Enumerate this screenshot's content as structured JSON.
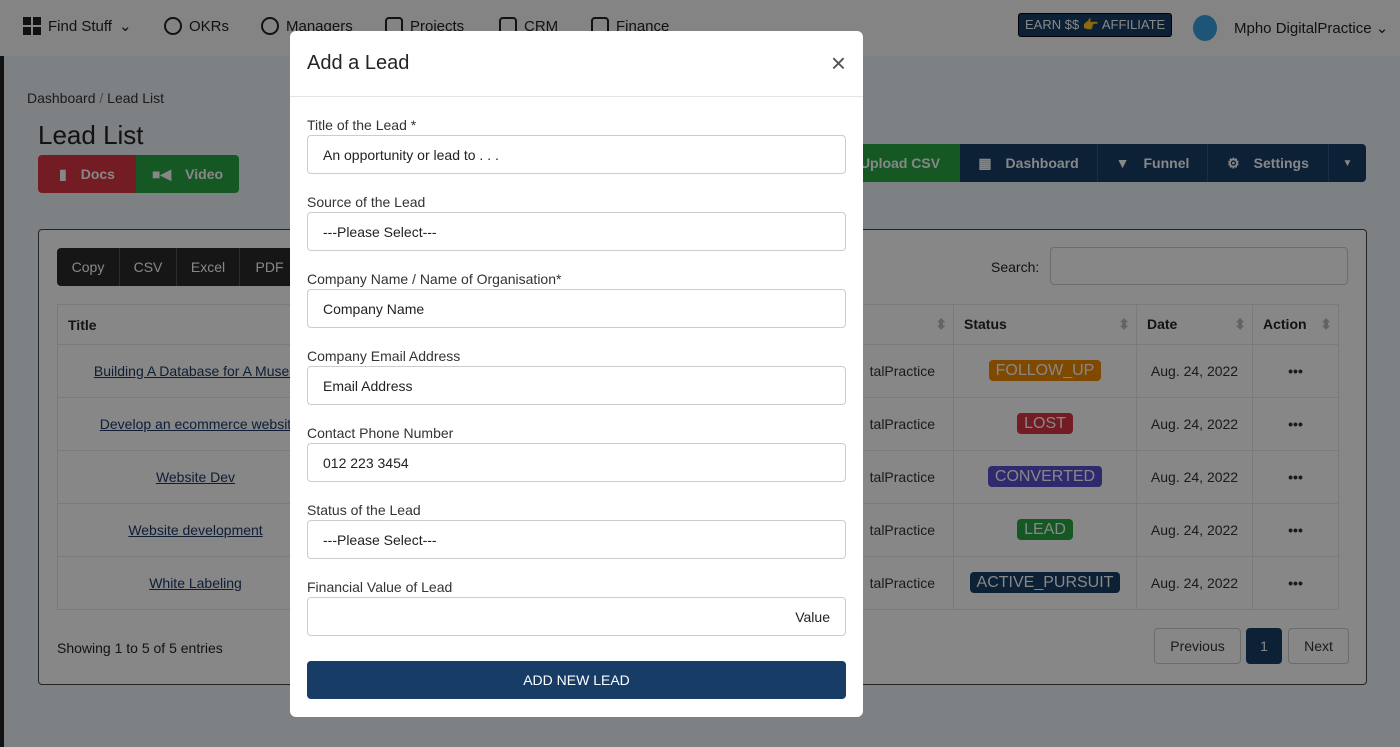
{
  "nav": {
    "items": [
      "Find Stuff",
      "OKRs",
      "Managers",
      "Projects",
      "CRM",
      "Finance"
    ],
    "affiliate": "EARN $$ 👉 AFFILIATE",
    "user": "Mpho DigitalPractice"
  },
  "breadcrumb": [
    "Dashboard",
    "/",
    "Lead List"
  ],
  "page_title": "Lead List",
  "buttons": {
    "docs": "Docs",
    "video": "Video",
    "upload": "Upload CSV",
    "dashboard": "Dashboard",
    "funnel": "Funnel",
    "settings": "Settings"
  },
  "export": [
    "Copy",
    "CSV",
    "Excel",
    "PDF"
  ],
  "search_label": "Search:",
  "table": {
    "headers": {
      "title": "Title",
      "status": "Status",
      "date": "Date",
      "action": "Action"
    },
    "rows": [
      {
        "title": "Building A Database for A Museu",
        "owner": "talPractice",
        "status": "FOLLOW_UP",
        "color": "#f08c00",
        "date": "Aug. 24, 2022"
      },
      {
        "title": "Develop an ecommerce websit",
        "owner": "talPractice",
        "status": "LOST",
        "color": "#dc3545",
        "date": "Aug. 24, 2022"
      },
      {
        "title": "Website Dev",
        "owner": "talPractice",
        "status": "CONVERTED",
        "color": "#5a4fcf",
        "date": "Aug. 24, 2022"
      },
      {
        "title": "Website development",
        "owner": "talPractice",
        "status": "LEAD",
        "color": "#28a745",
        "date": "Aug. 24, 2022"
      },
      {
        "title": "White Labeling",
        "owner": "talPractice",
        "status": "ACTIVE_PURSUIT",
        "color": "#173d66",
        "date": "Aug. 24, 2022"
      }
    ]
  },
  "footer": {
    "info": "Showing 1 to 5 of 5 entries",
    "prev": "Previous",
    "page": "1",
    "next": "Next"
  },
  "modal": {
    "title": "Add a Lead",
    "fields": [
      {
        "label": "Title of the Lead *",
        "value": "An opportunity or lead to  . . ."
      },
      {
        "label": "Source of the Lead",
        "value": "---Please Select---"
      },
      {
        "label": "Company Name / Name of Organisation*",
        "value": "Company Name"
      },
      {
        "label": "Company Email Address",
        "value": "Email Address"
      },
      {
        "label": "Contact Phone Number",
        "value": "012 223 3454"
      },
      {
        "label": "Status of the  Lead",
        "value": "---Please Select---"
      },
      {
        "label": "Financial Value of Lead",
        "value": "Value"
      }
    ],
    "submit": "ADD NEW LEAD"
  }
}
